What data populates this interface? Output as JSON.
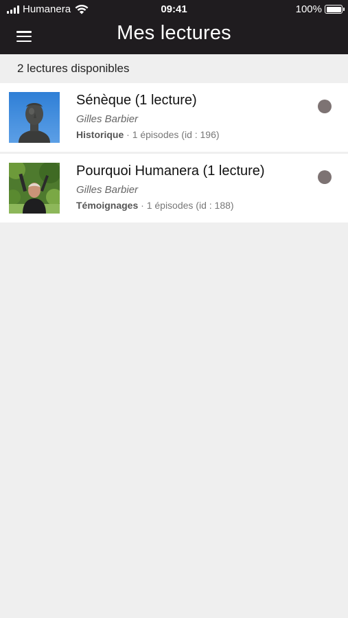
{
  "status_bar": {
    "carrier": "Humanera",
    "time": "09:41",
    "battery": "100%"
  },
  "header": {
    "title": "Mes lectures",
    "menu_icon": "hamburger-menu-icon"
  },
  "summary": {
    "count_text": "2 lectures disponibles"
  },
  "readings": [
    {
      "title": "Sénèque (1 lecture)",
      "author": "Gilles Barbier",
      "category": "Historique",
      "separator": " · ",
      "details": "1 épisodes (id : 196)",
      "thumbnail": "seneca-bust-statue",
      "status_color": "#7d7373"
    },
    {
      "title": "Pourquoi Humanera (1 lecture)",
      "author": "Gilles Barbier",
      "category": "Témoignages",
      "separator": " · ",
      "details": "1 épisodes (id : 188)",
      "thumbnail": "man-in-garden-photo",
      "status_color": "#7d7373"
    }
  ],
  "colors": {
    "header_bg": "#1f1c1f",
    "page_bg": "#efefef",
    "card_bg": "#ffffff"
  }
}
